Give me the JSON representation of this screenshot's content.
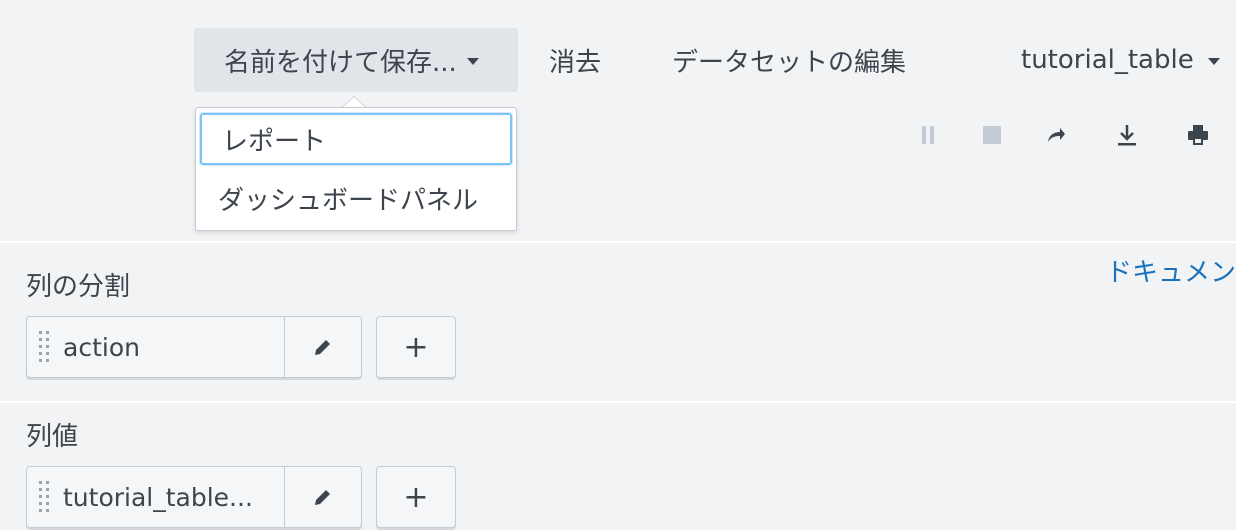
{
  "toolbar": {
    "save_as_label": "名前を付けて保存...",
    "clear_label": "消去",
    "edit_dataset_label": "データセットの編集",
    "dataset_selected": "tutorial_table"
  },
  "save_menu": {
    "items": [
      {
        "label": "レポート",
        "focused": true
      },
      {
        "label": "ダッシュボードパネル",
        "focused": false
      }
    ]
  },
  "job_icons": [
    "pause-icon",
    "stop-icon",
    "share-icon",
    "export-icon",
    "print-icon"
  ],
  "documentation_link": "ドキュメン",
  "column_split": {
    "label": "列の分割",
    "field": "action",
    "add_label": "+"
  },
  "column_values": {
    "label": "列値",
    "field": "tutorial_table...",
    "add_label": "+"
  },
  "colors": {
    "background": "#f2f3f5",
    "link": "#1a72bd",
    "focus": "#7cc4f5",
    "button_bg": "#e1e4e8"
  }
}
